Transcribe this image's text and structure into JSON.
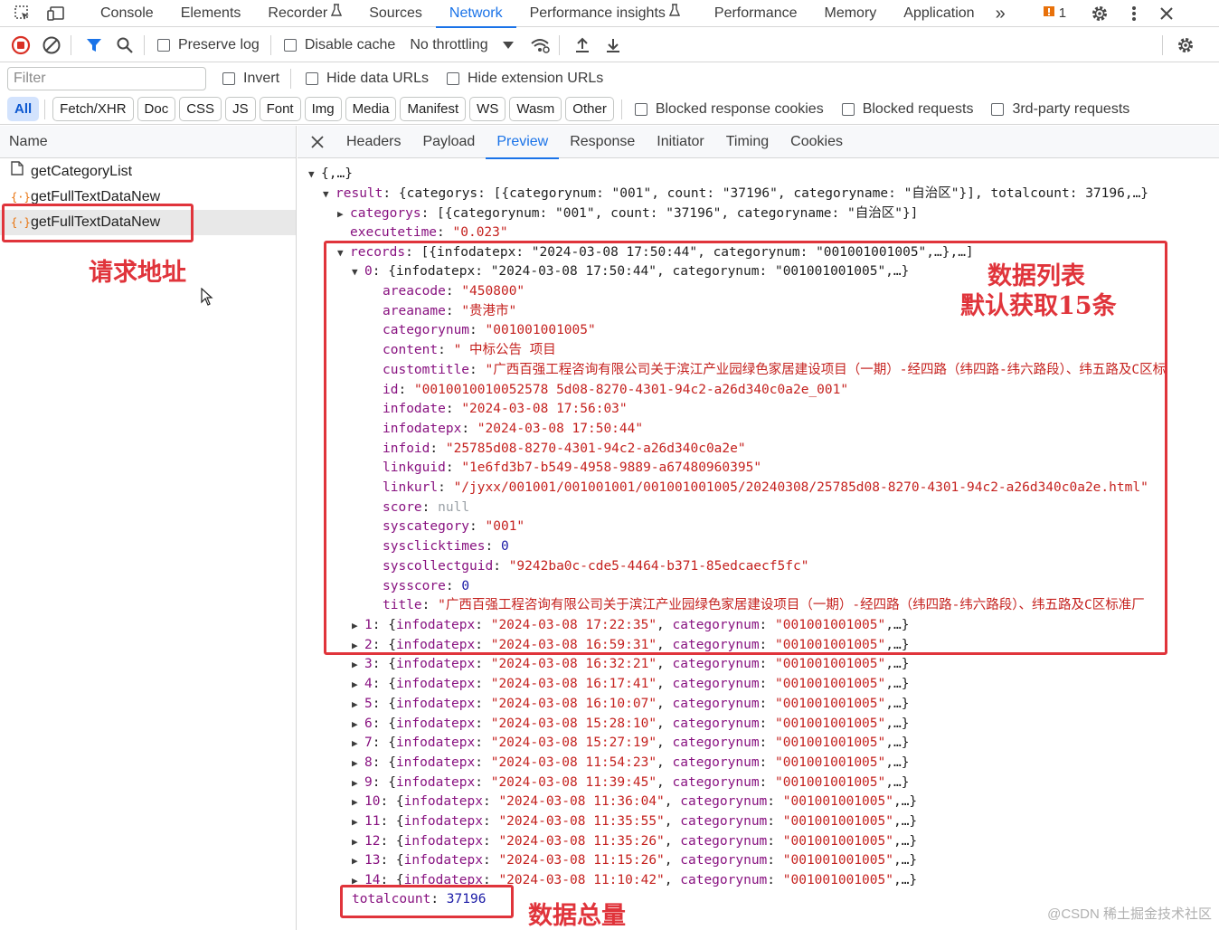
{
  "tabbar": {
    "tabs": [
      "Console",
      "Elements",
      "Recorder",
      "Sources",
      "Network",
      "Performance insights",
      "Performance",
      "Memory",
      "Application"
    ],
    "active": "Network",
    "more": "»",
    "issues_count": "1"
  },
  "toolbar": {
    "preserve_log": "Preserve log",
    "disable_cache": "Disable cache",
    "throttling": "No throttling"
  },
  "filterrow": {
    "filter_placeholder": "Filter",
    "invert": "Invert",
    "hide_data_urls": "Hide data URLs",
    "hide_extension_urls": "Hide extension URLs"
  },
  "typerow": {
    "types": [
      "All",
      "Fetch/XHR",
      "Doc",
      "CSS",
      "JS",
      "Font",
      "Img",
      "Media",
      "Manifest",
      "WS",
      "Wasm",
      "Other"
    ],
    "blocked_cookies": "Blocked response cookies",
    "blocked_requests": "Blocked requests",
    "third_party": "3rd-party requests"
  },
  "requests": {
    "header": "Name",
    "items": [
      {
        "name": "getCategoryList",
        "kind": "doc"
      },
      {
        "name": "getFullTextDataNew",
        "kind": "xhr"
      },
      {
        "name": "getFullTextDataNew",
        "kind": "xhr"
      }
    ]
  },
  "detail_tabs": [
    "Headers",
    "Payload",
    "Preview",
    "Response",
    "Initiator",
    "Timing",
    "Cookies"
  ],
  "preview": {
    "root": "{,…}",
    "result_key": "result",
    "result_summary": "{categorys: [{categorynum: \"001\", count: \"37196\", categoryname: \"自治区\"}], totalcount: 37196,…}",
    "categorys_key": "categorys",
    "categorys_summary": "[{categorynum: \"001\", count: \"37196\", categoryname: \"自治区\"}]",
    "executetime_key": "executetime",
    "executetime_val": "\"0.023\"",
    "records_key": "records",
    "records_summary": "[{infodatepx: \"2024-03-08 17:50:44\", categorynum: \"001001001005\",…},…]",
    "record0_summary": "{infodatepx: \"2024-03-08 17:50:44\", categorynum: \"001001001005\",…}",
    "fields": [
      {
        "k": "areacode",
        "v": "\"450800\"",
        "t": "s"
      },
      {
        "k": "areaname",
        "v": "\"贵港市\"",
        "t": "s"
      },
      {
        "k": "categorynum",
        "v": "\"001001001005\"",
        "t": "s"
      },
      {
        "k": "content",
        "v": "\"                     中标公告                              项目",
        "t": "s"
      },
      {
        "k": "customtitle",
        "v": "\"广西百强工程咨询有限公司关于滨江产业园绿色家居建设项目（一期）-经四路（纬四路-纬六路段）、纬五路及C区标",
        "t": "s"
      },
      {
        "k": "id",
        "v": "\"0010010010052578 5d08-8270-4301-94c2-a26d340c0a2e_001\"",
        "t": "s"
      },
      {
        "k": "infodate",
        "v": "\"2024-03-08 17:56:03\"",
        "t": "s"
      },
      {
        "k": "infodatepx",
        "v": "\"2024-03-08 17:50:44\"",
        "t": "s"
      },
      {
        "k": "infoid",
        "v": "\"25785d08-8270-4301-94c2-a26d340c0a2e\"",
        "t": "s"
      },
      {
        "k": "linkguid",
        "v": "\"1e6fd3b7-b549-4958-9889-a67480960395\"",
        "t": "s"
      },
      {
        "k": "linkurl",
        "v": "\"/jyxx/001001/001001001/001001001005/20240308/25785d08-8270-4301-94c2-a26d340c0a2e.html\"",
        "t": "s"
      },
      {
        "k": "score",
        "v": "null",
        "t": "nl"
      },
      {
        "k": "syscategory",
        "v": "\"001\"",
        "t": "s"
      },
      {
        "k": "sysclicktimes",
        "v": "0",
        "t": "n"
      },
      {
        "k": "syscollectguid",
        "v": "\"9242ba0c-cde5-4464-b371-85edcaecf5fc\"",
        "t": "s"
      },
      {
        "k": "sysscore",
        "v": "0",
        "t": "n"
      },
      {
        "k": "title",
        "v": "\"广西百强工程咨询有限公司关于滨江产业园绿色家居建设项目（一期）-经四路（纬四路-纬六路段）、纬五路及C区标准厂",
        "t": "s"
      }
    ],
    "records": [
      {
        "idx": "1",
        "date": "2024-03-08 17:22:35"
      },
      {
        "idx": "2",
        "date": "2024-03-08 16:59:31"
      },
      {
        "idx": "3",
        "date": "2024-03-08 16:32:21"
      },
      {
        "idx": "4",
        "date": "2024-03-08 16:17:41"
      },
      {
        "idx": "5",
        "date": "2024-03-08 16:10:07"
      },
      {
        "idx": "6",
        "date": "2024-03-08 15:28:10"
      },
      {
        "idx": "7",
        "date": "2024-03-08 15:27:19"
      },
      {
        "idx": "8",
        "date": "2024-03-08 11:54:23"
      },
      {
        "idx": "9",
        "date": "2024-03-08 11:39:45"
      },
      {
        "idx": "10",
        "date": "2024-03-08 11:36:04"
      },
      {
        "idx": "11",
        "date": "2024-03-08 11:35:55"
      },
      {
        "idx": "12",
        "date": "2024-03-08 11:35:26"
      },
      {
        "idx": "13",
        "date": "2024-03-08 11:15:26"
      },
      {
        "idx": "14",
        "date": "2024-03-08 11:10:42"
      }
    ],
    "record_categorynum": "001001001005",
    "totalcount_key": "totalcount",
    "totalcount_val": "37196"
  },
  "annotations": {
    "request_url": "请求地址",
    "data_list_1": "数据列表",
    "data_list_2": "默认获取15条",
    "data_total": "数据总量"
  },
  "watermark": "@CSDN 稀土掘金技术社区",
  "colors": {
    "annotation": "#e0343b",
    "accent": "#1a73e8",
    "key": "#881280",
    "string": "#c5221f",
    "number": "#1a1aa6"
  }
}
